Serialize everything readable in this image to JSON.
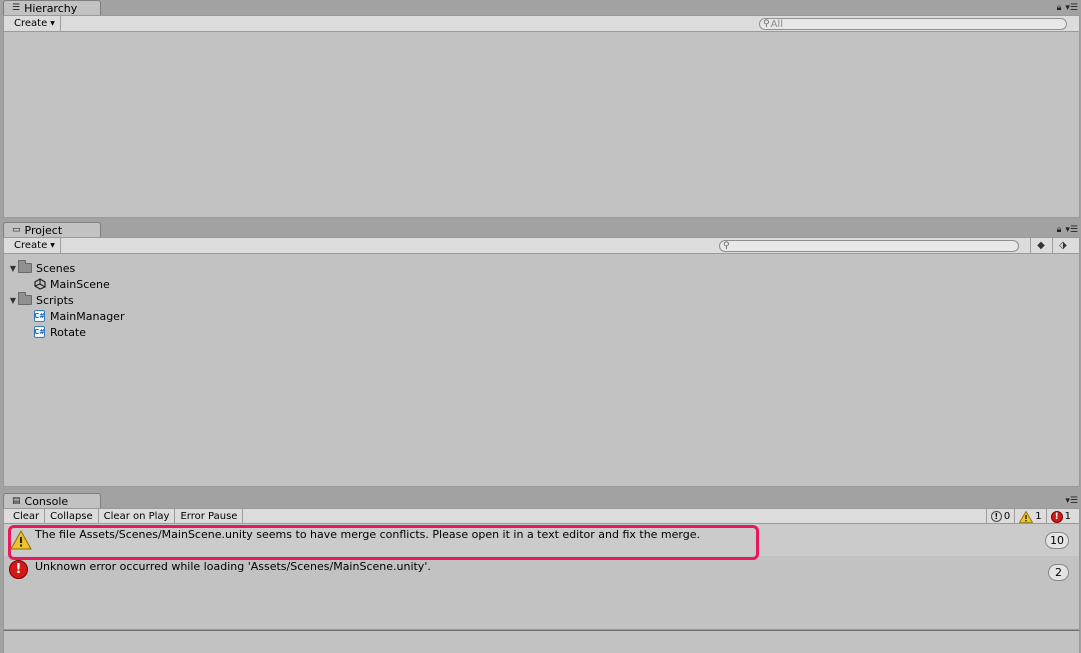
{
  "hierarchy": {
    "tab_title": "Hierarchy",
    "create_label": "Create",
    "search_placeholder": "All"
  },
  "project": {
    "tab_title": "Project",
    "create_label": "Create",
    "tree": {
      "folder_scenes": "Scenes",
      "item_main_scene": "MainScene",
      "folder_scripts": "Scripts",
      "item_main_manager": "MainManager",
      "item_rotate": "Rotate"
    }
  },
  "console": {
    "tab_title": "Console",
    "buttons": {
      "clear": "Clear",
      "collapse": "Collapse",
      "clear_on_play": "Clear on Play",
      "error_pause": "Error Pause"
    },
    "counts": {
      "info": "0",
      "warning": "1",
      "error": "1"
    },
    "logs": {
      "warning_message": "The file Assets/Scenes/MainScene.unity seems to have merge conflicts. Please open it in a text editor and fix the merge.",
      "warning_count": "10",
      "error_message": "Unknown error occurred while loading 'Assets/Scenes/MainScene.unity'.",
      "error_count": "2"
    }
  },
  "colors": {
    "highlight": "#e8195a",
    "error": "#d41818",
    "warning": "#f0c22a"
  }
}
